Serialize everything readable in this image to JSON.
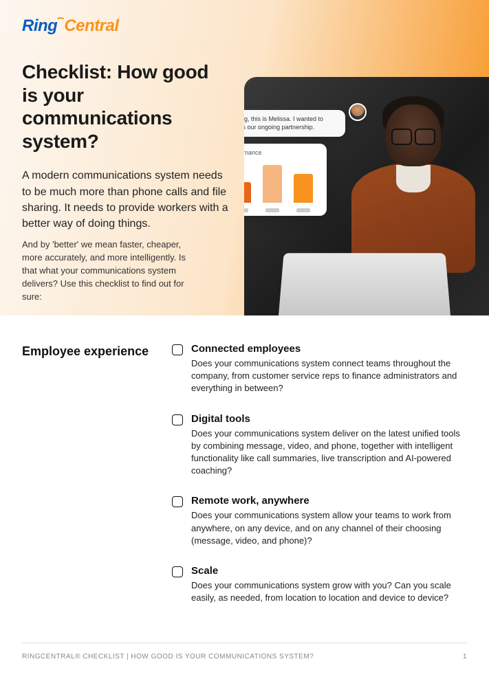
{
  "brand": {
    "part1": "Ring",
    "part2": "Central"
  },
  "hero": {
    "title": "Checklist: How good is your communications system?",
    "lead": "A modern communications system needs to be much more than phone calls and file sharing. It needs to provide workers with a better way of doing things.",
    "sub": "And by 'better' we mean faster, cheaper, more accurately, and more intelligently. Is that what your communications system delivers? Use this checklist to find out for sure:"
  },
  "overlay": {
    "chat": "Hi Irving, this is Melissa. I wanted to discuss our ongoing partnership.",
    "perf_label": "Performance"
  },
  "chart_data": {
    "type": "bar",
    "title": "Performance",
    "categories": [
      "",
      "",
      ""
    ],
    "values": [
      30,
      55,
      42
    ],
    "colors": [
      "#e8651a",
      "#f5b680",
      "#f7931e"
    ],
    "ylim": [
      0,
      60
    ]
  },
  "section": {
    "heading": "Employee experience",
    "items": [
      {
        "title": "Connected employees",
        "desc": "Does your communications system connect teams throughout the company, from customer service reps to finance administrators and everything in between?"
      },
      {
        "title": "Digital tools",
        "desc": "Does your communications system deliver on the latest unified tools by combining message, video, and phone, together with intelligent functionality like call summaries, live transcription and AI-powered coaching?"
      },
      {
        "title": "Remote work, anywhere",
        "desc": "Does your communications system allow your teams to work from anywhere, on any device, and on any channel of their choosing (message, video, and phone)?"
      },
      {
        "title": "Scale",
        "desc": "Does your communications system grow with you? Can you scale easily, as needed, from location to location and device to device?"
      }
    ]
  },
  "footer": {
    "left": "RINGCENTRAL® CHECKLIST | HOW GOOD IS YOUR COMMUNICATIONS SYSTEM?",
    "page": "1"
  }
}
